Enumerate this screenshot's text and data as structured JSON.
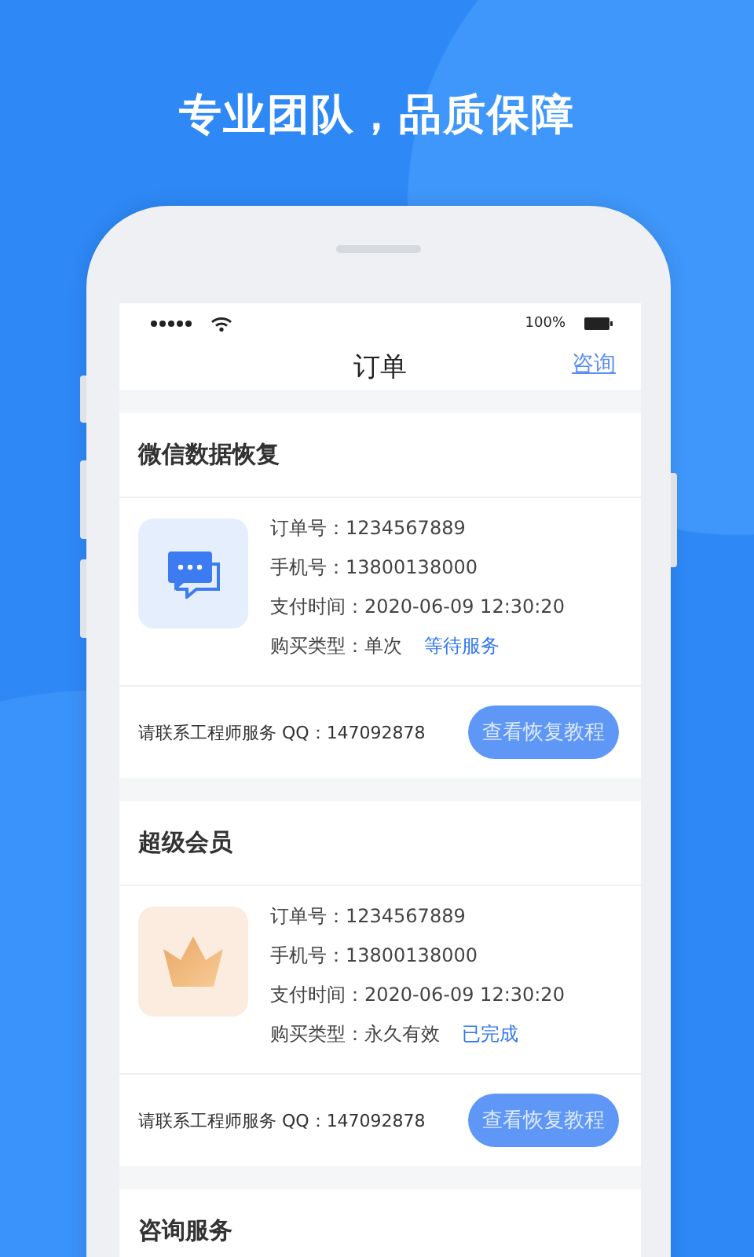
{
  "headline": "专业团队，品质保障",
  "status_bar": {
    "battery": "100%"
  },
  "nav": {
    "title": "订单",
    "action": "咨询"
  },
  "orders": [
    {
      "title": "微信数据恢复",
      "kind": "chat",
      "rows": [
        "订单号：1234567889",
        "手机号：13800138000",
        "支付时间：2020-06-09 12:30:20"
      ],
      "purchase_type": "购买类型：单次",
      "status": "等待服务",
      "contact": "请联系工程师服务 QQ：147092878",
      "button": "查看恢复教程"
    },
    {
      "title": "超级会员",
      "kind": "crown",
      "rows": [
        "订单号：1234567889",
        "手机号：13800138000",
        "支付时间：2020-06-09 12:30:20"
      ],
      "purchase_type": "购买类型：永久有效",
      "status": "已完成",
      "contact": "请联系工程师服务 QQ：147092878",
      "button": "查看恢复教程"
    },
    {
      "title": "咨询服务"
    }
  ]
}
